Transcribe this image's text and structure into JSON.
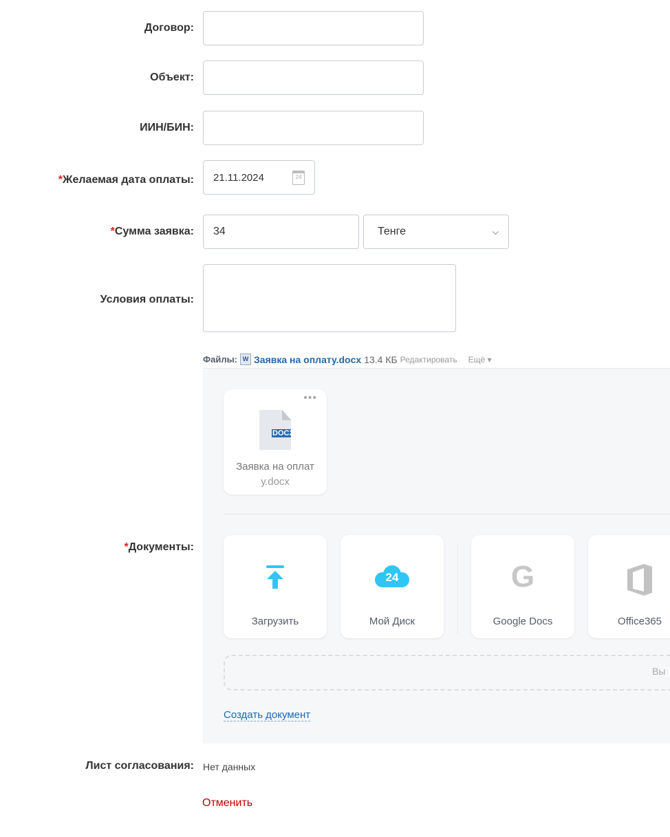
{
  "fields": {
    "contract_label": "Договор:",
    "object_label": "Объект:",
    "iin_label": "ИИН/БИН:",
    "date_label": "Желаемая дата оплаты:",
    "date_value": "21.11.2024",
    "sum_label": "Сумма заявка:",
    "sum_value": "34",
    "currency_value": "Тенге",
    "terms_label": "Условия оплаты:",
    "required_mark": "*"
  },
  "files": {
    "label": "Файлы:",
    "file_name": "Заявка на оплату.docx",
    "file_size": "13.4 КБ",
    "edit": "Редактировать",
    "more": "Ещё",
    "card_name_1": "Заявка на оплат",
    "card_name_2": "у.docx",
    "card_ext": "DOCX"
  },
  "documents": {
    "label": "Документы:",
    "upload": "Загрузить",
    "my_disk": "Мой Диск",
    "disk_badge": "24",
    "google": "Google Docs",
    "office": "Office365",
    "drop_hint": "Вы",
    "create": "Создать документ"
  },
  "approval": {
    "label": "Лист согласования:",
    "value": "Нет данных"
  },
  "cancel": "Отменить",
  "colors": {
    "accent": "#2fc6f6",
    "link": "#2067b0",
    "cancel": "#c00000"
  }
}
